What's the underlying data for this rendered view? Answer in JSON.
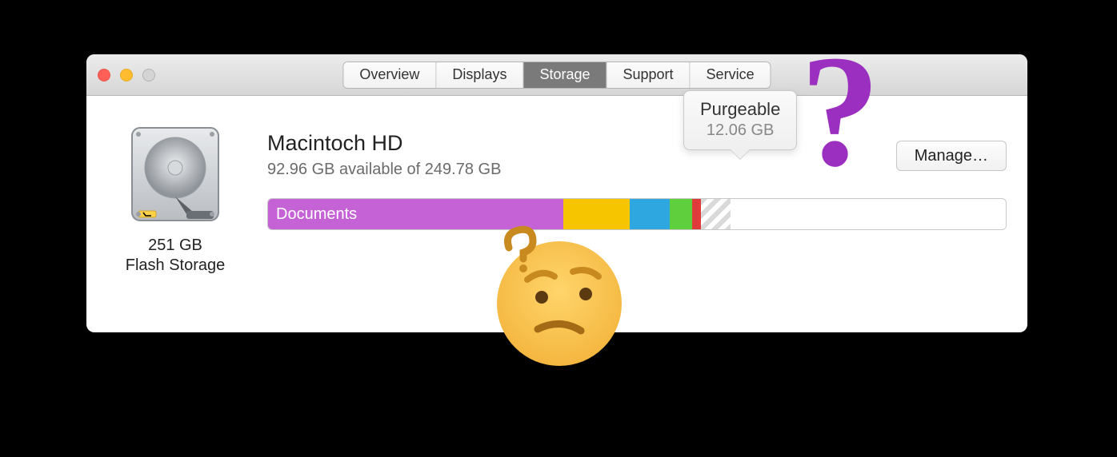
{
  "tabs": {
    "items": [
      "Overview",
      "Displays",
      "Storage",
      "Support",
      "Service"
    ],
    "active_index": 2
  },
  "drive": {
    "capacity": "251 GB",
    "type": "Flash Storage"
  },
  "disk": {
    "name": "Macintoch HD",
    "subtitle": "92.96 GB available of 249.78 GB"
  },
  "manage_label": "Manage…",
  "bar": {
    "segments": [
      {
        "label": "Documents",
        "color": "#c562d6",
        "pct": 40.0
      },
      {
        "label": "",
        "color": "#f7c400",
        "pct": 9.0
      },
      {
        "label": "",
        "color": "#2ea7e0",
        "pct": 5.5
      },
      {
        "label": "",
        "color": "#5fcf3d",
        "pct": 3.0
      },
      {
        "label": "",
        "color": "#e03a3a",
        "pct": 1.2
      },
      {
        "label": "",
        "hatched": true,
        "pct": 4.0
      },
      {
        "label": "",
        "color": "#ffffff",
        "pct": 37.3
      }
    ]
  },
  "tooltip": {
    "title": "Purgeable",
    "value": "12.06 GB"
  },
  "traffic": {
    "close": "red",
    "min": "yellow",
    "max": "disabled"
  }
}
